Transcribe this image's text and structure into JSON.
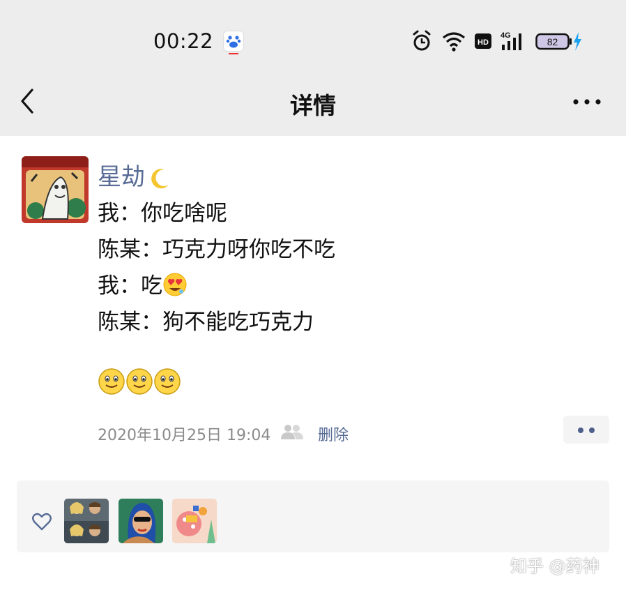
{
  "status_bar": {
    "time": "00:22",
    "battery_level": "82",
    "network": "4G",
    "hd_badge": "HD",
    "icons": [
      "baidu-icon",
      "alarm-icon",
      "wifi-icon",
      "hd-icon",
      "signal-icon",
      "battery-icon",
      "charging-icon"
    ]
  },
  "nav": {
    "title": "详情",
    "back_icon": "chevron-left-icon",
    "more_icon": "more-dots-icon"
  },
  "post": {
    "username": "星劫",
    "username_emoji": "crescent-moon",
    "lines": [
      "我：你吃啥呢",
      "陈某：巧克力呀你吃不吃",
      "我：吃",
      "陈某：狗不能吃巧克力"
    ],
    "line3_emoji": "smiling-face-with-heart-eyes",
    "smile_emojis": [
      "slightly-smiling-face",
      "slightly-smiling-face",
      "slightly-smiling-face"
    ],
    "timestamp": "2020年10月25日 19:04",
    "delete_label": "删除"
  },
  "likes": {
    "heart_icon": "heart-outline-icon",
    "avatars": [
      "couple-photo",
      "blue-hair-girl",
      "pink-cartoon"
    ]
  },
  "watermark": "知乎 @药神",
  "colors": {
    "link": "#576b95",
    "bar_bg": "#ededed",
    "likes_bg": "#f5f5f5",
    "timestamp": "#8a8a8a"
  }
}
